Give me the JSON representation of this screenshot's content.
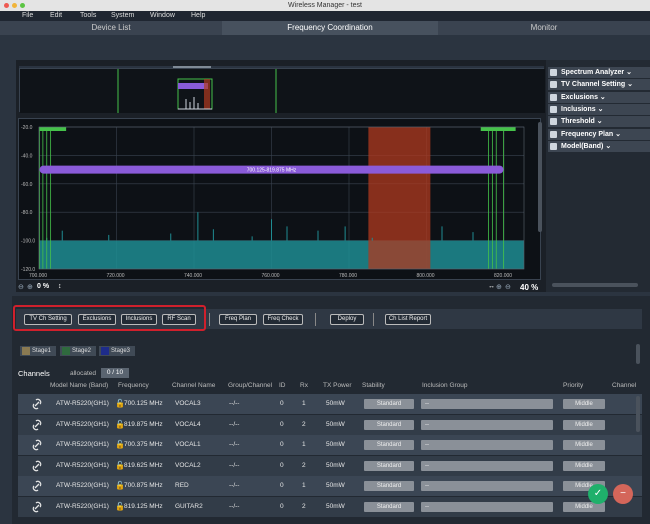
{
  "window": {
    "title": "Wireless Manager - test"
  },
  "menu": [
    "File",
    "Edit",
    "Tools",
    "System",
    "Window",
    "Help"
  ],
  "tabs": [
    "Device List",
    "Frequency Coordination",
    "Monitor"
  ],
  "sidebar": [
    {
      "label": "Spectrum Analyzer"
    },
    {
      "label": "TV Channel Setting"
    },
    {
      "label": "Exclusions"
    },
    {
      "label": "Inclusions"
    },
    {
      "label": "Threshold"
    },
    {
      "label": "Frequency Plan"
    },
    {
      "label": "Model(Band)"
    }
  ],
  "plot": {
    "y_ticks": [
      "-20.0",
      "-40.0",
      "-60.0",
      "-80.0",
      "-100.0",
      "-120.0"
    ],
    "x_ticks": [
      "700.000",
      "720.000",
      "740.000",
      "760.000",
      "780.000",
      "800.000",
      "820.000"
    ],
    "band_label": "700.125-819.875 MHz",
    "zoom_left": "0 %",
    "zoom_right": "40 %",
    "colors": {
      "band": "#8a5bd9",
      "noise": "#1f8c92",
      "exclusion": "#b03a1f",
      "marker": "#45c24a"
    }
  },
  "toolbar": {
    "tv_ch_setting": "TV Ch Setting",
    "exclusions": "Exclusions",
    "inclusions": "Inclusions",
    "rf_scan": "RF Scan",
    "freq_plan": "Freq Plan",
    "freq_check": "Freq Check",
    "deploy": "Deploy",
    "ch_list_report": "Ch List Report"
  },
  "stages": [
    {
      "label": "Stage1",
      "color": "#8a7a52"
    },
    {
      "label": "Stage2",
      "color": "#2f6a3e"
    },
    {
      "label": "Stage3",
      "color": "#1e2c8a"
    }
  ],
  "channels": {
    "title": "Channels",
    "allocated_label": "allocated",
    "allocated_value": "0 / 10",
    "headers": [
      "Model Name (Band)",
      "Frequency",
      "Channel Name",
      "Group/Channel",
      "ID",
      "Rx",
      "TX Power",
      "Stability",
      "Inclusion Group",
      "Priority",
      "Channel"
    ],
    "rows": [
      {
        "model": "ATW-R5220(GH1)",
        "freq": "700.125 MHz",
        "name": "VOCAL3",
        "group": "--/--",
        "id": "0",
        "rx": "1",
        "power": "50mW",
        "stability": "Standard",
        "inclusion": "--",
        "priority": "Middle"
      },
      {
        "model": "ATW-R5220(GH1)",
        "freq": "819.875 MHz",
        "name": "VOCAL4",
        "group": "--/--",
        "id": "0",
        "rx": "2",
        "power": "50mW",
        "stability": "Standard",
        "inclusion": "--",
        "priority": "Middle"
      },
      {
        "model": "ATW-R5220(GH1)",
        "freq": "700.375 MHz",
        "name": "VOCAL1",
        "group": "--/--",
        "id": "0",
        "rx": "1",
        "power": "50mW",
        "stability": "Standard",
        "inclusion": "--",
        "priority": "Middle"
      },
      {
        "model": "ATW-R5220(GH1)",
        "freq": "819.625 MHz",
        "name": "VOCAL2",
        "group": "--/--",
        "id": "0",
        "rx": "2",
        "power": "50mW",
        "stability": "Standard",
        "inclusion": "--",
        "priority": "Middle"
      },
      {
        "model": "ATW-R5220(GH1)",
        "freq": "700.875 MHz",
        "name": "RED",
        "group": "--/--",
        "id": "0",
        "rx": "1",
        "power": "50mW",
        "stability": "Standard",
        "inclusion": "--",
        "priority": "Middle"
      },
      {
        "model": "ATW-R5220(GH1)",
        "freq": "819.125 MHz",
        "name": "GUITAR2",
        "group": "--/--",
        "id": "0",
        "rx": "2",
        "power": "50mW",
        "stability": "Standard",
        "inclusion": "--",
        "priority": "Middle"
      }
    ]
  }
}
